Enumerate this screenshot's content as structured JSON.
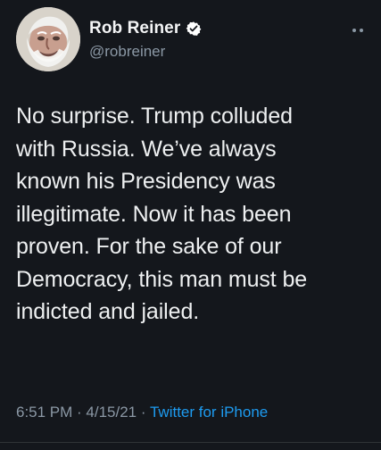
{
  "tweet": {
    "author": {
      "display_name": "Rob Reiner",
      "handle": "@robreiner",
      "verified": true,
      "avatar_icon": "avatar-photo"
    },
    "text": "No surprise. Trump colluded\nwith Russia. We’ve always\nknown his Presidency was\nillegitimate. Now it has been\nproven. For the sake of our\nDemocracy, this man must be\nindicted and jailed.",
    "timestamp": {
      "time": "6:51 PM",
      "separator_1": " · ",
      "date": "4/15/21",
      "separator_2": " · ",
      "source": "Twitter for iPhone"
    }
  },
  "colors": {
    "background": "#14171c",
    "text": "#eef0f1",
    "secondary": "#8b98a5",
    "accent": "#1d9bf0"
  }
}
